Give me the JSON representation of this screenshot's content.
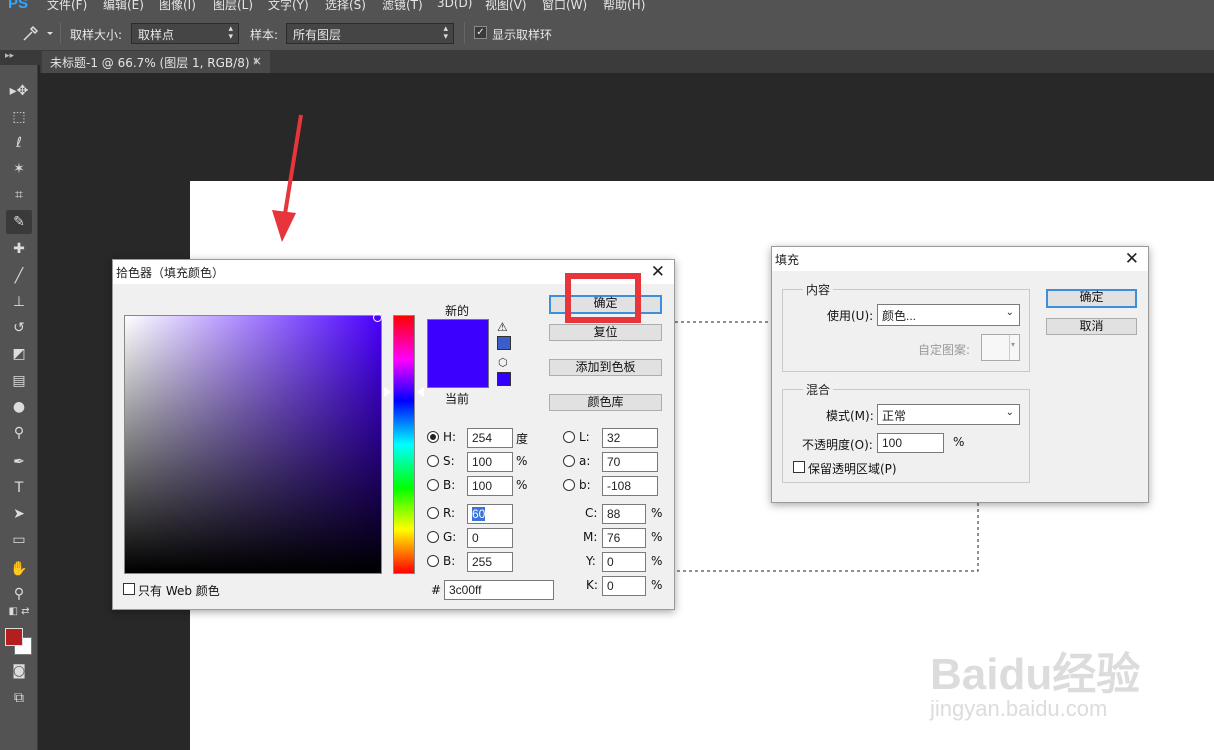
{
  "menubar": {
    "logo": "PS",
    "items": [
      "文件(F)",
      "编辑(E)",
      "图像(I)",
      "图层(L)",
      "文字(Y)",
      "选择(S)",
      "滤镜(T)",
      "3D(D)",
      "视图(V)",
      "窗口(W)",
      "帮助(H)"
    ]
  },
  "options": {
    "tool_icon": "eyedropper-icon",
    "sample_size_label": "取样大小:",
    "sample_size_value": "取样点",
    "sample_label": "样本:",
    "sample_value": "所有图层",
    "show_ring_label": "显示取样环",
    "show_ring_checked": true
  },
  "document_tab": {
    "title": "未标题-1 @ 66.7% (图层 1, RGB/8) *",
    "close": "×"
  },
  "toolbar": {
    "header": "▸▸",
    "tools": [
      "move-icon",
      "marquee-icon",
      "lasso-icon",
      "magic-wand-icon",
      "crop-icon",
      "eyedropper-icon",
      "healing-brush-icon",
      "brush-icon",
      "clone-stamp-icon",
      "history-brush-icon",
      "eraser-icon",
      "gradient-icon",
      "blur-icon",
      "dodge-icon",
      "pen-icon",
      "type-icon",
      "path-selection-icon",
      "rectangle-icon",
      "hand-icon",
      "zoom-icon",
      "quick-mask-icon",
      "screen-mode-icon"
    ],
    "foreground_color": "#b41e1e",
    "background_color": "#ffffff"
  },
  "color_picker": {
    "title": "拾色器（填充颜色）",
    "close": "✕",
    "new_label": "新的",
    "current_label": "当前",
    "new_color": "#3c00ff",
    "current_color": "#3c00ff",
    "buttons": {
      "ok": "确定",
      "reset": "复位",
      "add_swatch": "添加到色板",
      "color_libraries": "颜色库"
    },
    "hsb": {
      "h_label": "H:",
      "h_value": "254",
      "h_unit": "度",
      "s_label": "S:",
      "s_value": "100",
      "s_unit": "%",
      "b_label": "B:",
      "b_value": "100",
      "b_unit": "%"
    },
    "rgb": {
      "r_label": "R:",
      "r_value": "60",
      "g_label": "G:",
      "g_value": "0",
      "b_label": "B:",
      "b_value": "255"
    },
    "lab": {
      "l_label": "L:",
      "l_value": "32",
      "a_label": "a:",
      "a_value": "70",
      "b_label": "b:",
      "b_value": "-108"
    },
    "cmyk": {
      "c_label": "C:",
      "c_value": "88",
      "m_label": "M:",
      "m_value": "76",
      "y_label": "Y:",
      "y_value": "0",
      "k_label": "K:",
      "k_value": "0",
      "unit": "%"
    },
    "hex_label": "#",
    "hex_value": "3c00ff",
    "web_only_label": "只有 Web 颜色",
    "selected_mode": "H"
  },
  "fill_dialog": {
    "title": "填充",
    "close": "✕",
    "content_group": "内容",
    "use_label": "使用(U):",
    "use_value": "颜色...",
    "custom_pattern_label": "自定图案:",
    "blend_group": "混合",
    "mode_label": "模式(M):",
    "mode_value": "正常",
    "opacity_label": "不透明度(O):",
    "opacity_value": "100",
    "opacity_unit": "%",
    "preserve_label": "保留透明区域(P)",
    "ok": "确定",
    "cancel": "取消"
  },
  "watermark": {
    "brand": "Baidu经验",
    "url": "jingyan.baidu.com"
  }
}
